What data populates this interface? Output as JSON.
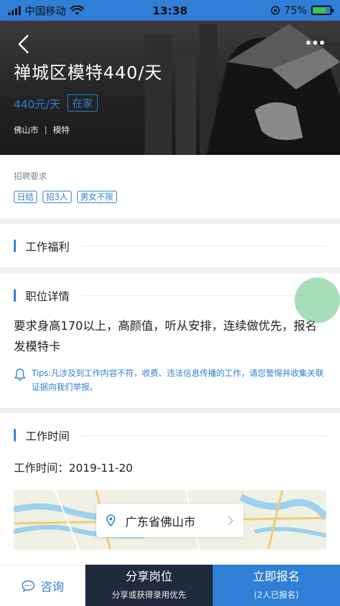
{
  "status_bar": {
    "carrier": "中国移动",
    "time": "13:38",
    "battery": "75%",
    "battery_level": 0.75
  },
  "header": {
    "back_icon": "chevron-left-icon",
    "more_icon": "more-dots-icon",
    "title": "禅城区模特440/天",
    "price": "440元/天",
    "work_mode_tag": "在家",
    "city": "佛山市",
    "category": "模特"
  },
  "requirements": {
    "label": "招聘要求",
    "tags": [
      "日结",
      "招3人",
      "男女不限"
    ]
  },
  "sections": {
    "welfare_title": "工作福利",
    "detail_title": "职位详情",
    "time_title": "工作时间"
  },
  "detail": {
    "description": "要求身高170以上，高颜值，听从安排，连续做优先，报名发模特卡",
    "tips": "Tips:凡涉及到工作内容不符，收费、违法信息传播的工作，请您警惕并收集关联证据向我们举报。"
  },
  "work_time": {
    "text": "工作时间：2019-11-20"
  },
  "map": {
    "address": "广东省佛山市"
  },
  "bottom_bar": {
    "consult_label": "咨询",
    "share_label": "分享岗位",
    "share_sub": "分享或获得录用优先",
    "apply_label": "立即报名",
    "apply_sub": "(2人已报名)"
  },
  "colors": {
    "accent": "#2f7fd6",
    "dark_button": "#1f2a3b"
  }
}
